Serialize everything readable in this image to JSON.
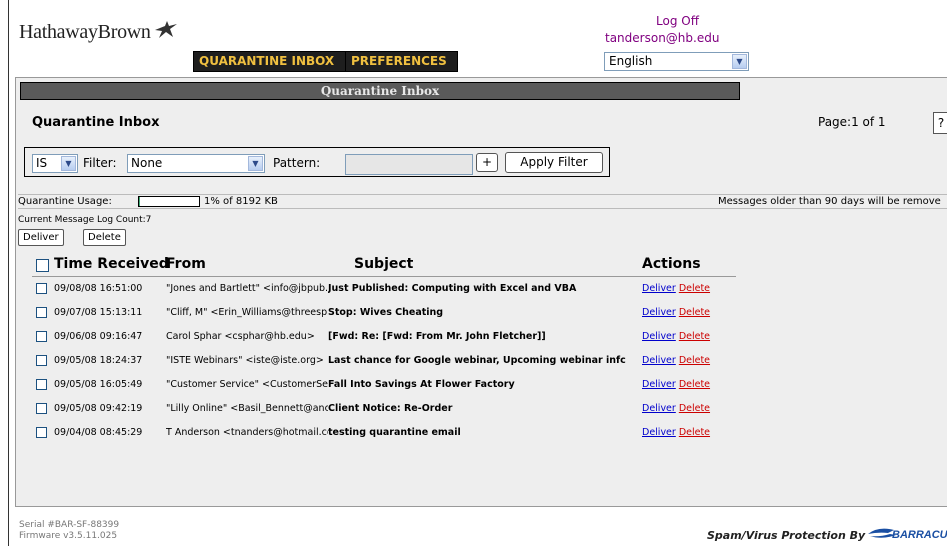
{
  "header": {
    "logo_text": "HathawayBrown",
    "tabs": [
      {
        "label": "QUARANTINE INBOX"
      },
      {
        "label": "PREFERENCES"
      }
    ],
    "logoff_label": "Log Off",
    "user_email": "tanderson@hb.edu",
    "language": "English"
  },
  "inbox": {
    "title_bar": "Quarantine Inbox",
    "heading": "Quarantine Inbox",
    "page_info": "Page:1 of 1",
    "help_label": "?",
    "filter": {
      "operator": "IS",
      "filter_label": "Filter:",
      "filter_value": "None",
      "pattern_label": "Pattern:",
      "pattern_value": "",
      "plus_label": "+",
      "apply_label": "Apply Filter"
    },
    "usage": {
      "label": "Quarantine Usage:",
      "percent": 1,
      "text": "1% of 8192 KB",
      "older_notice": "Messages older than 90 days will be remove"
    },
    "log_count": "Current Message Log Count:7",
    "buttons": {
      "deliver": "Deliver",
      "delete": "Delete"
    },
    "columns": {
      "time": "Time Received",
      "from": "From",
      "subject": "Subject",
      "actions": "Actions"
    },
    "messages": [
      {
        "time": "09/08/08 16:51:00",
        "from": "\"Jones and Bartlett\" <info@jbpub.co",
        "subject": "Just Published: Computing with Excel and VBA",
        "deliver": "Deliver",
        "delete": "Delete"
      },
      {
        "time": "09/07/08 15:13:11",
        "from": "\"Cliff, M\" <Erin_Williams@threespri",
        "subject": "Stop: Wives Cheating",
        "deliver": "Deliver",
        "delete": "Delete"
      },
      {
        "time": "09/06/08 09:16:47",
        "from": "Carol Sphar <csphar@hb.edu>",
        "subject": "[Fwd: Re: [Fwd: From Mr. John Fletcher]]",
        "deliver": "Deliver",
        "delete": "Delete"
      },
      {
        "time": "09/05/08 18:24:37",
        "from": "\"ISTE Webinars\" <iste@iste.org>",
        "subject": "Last chance for Google webinar, Upcoming webinar infc",
        "deliver": "Deliver",
        "delete": "Delete"
      },
      {
        "time": "09/05/08 16:05:49",
        "from": "\"Customer Service\" <CustomerSen",
        "subject": "Fall Into Savings At Flower Factory",
        "deliver": "Deliver",
        "delete": "Delete"
      },
      {
        "time": "09/05/08 09:42:19",
        "from": "\"Lilly Online\" <Basil_Bennett@ance",
        "subject": "Client Notice: Re-Order",
        "deliver": "Deliver",
        "delete": "Delete"
      },
      {
        "time": "09/04/08 08:45:29",
        "from": "T Anderson <tnanders@hotmail.com",
        "subject": "testing quarantine email",
        "deliver": "Deliver",
        "delete": "Delete"
      }
    ]
  },
  "footer": {
    "serial": "Serial #BAR-SF-88399",
    "firmware": "Firmware v3.5.11.025",
    "protection": "Spam/Virus Protection By",
    "brand": "BARRACUDA"
  },
  "colors": {
    "accent": "#f0c040",
    "tab_bg": "#1e1e1e",
    "link_blue": "#0000cc",
    "link_red": "#cc0000",
    "account_purple": "#800080"
  }
}
